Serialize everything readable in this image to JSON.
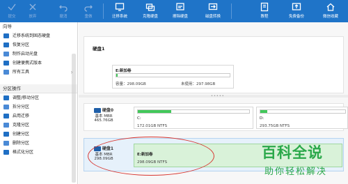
{
  "toolbar": {
    "commit": "提交",
    "discard": "放弃",
    "undo": "撤消",
    "redo": "重做",
    "migrate_os": "迁移系统",
    "clone_disk": "克隆硬盘",
    "wipe_disk": "擦除硬盘",
    "convert_disk": "磁盘转换",
    "tutorial": "教程",
    "free_backup": "免费备份",
    "wechat": "微信收藏"
  },
  "sidebar": {
    "wizard_header": "向导",
    "wizard_items": [
      "迁移系统到固态硬盘",
      "恢复分区",
      "制作启动光盘",
      "创建便携式版本",
      "所有工具"
    ],
    "partition_header": "分区操作",
    "partition_items": [
      "调整/移动分区",
      "拆分分区",
      "启用迁移",
      "克隆分区",
      "创建分区",
      "删除分区",
      "格式化分区"
    ]
  },
  "disk1_panel": {
    "title": "硬盘1",
    "volume_name": "E:新加卷",
    "capacity": "容量：298.09GB",
    "unused": "未使用：297.98GB",
    "used_fraction": 0.0004
  },
  "disk0": {
    "name": "硬盘0",
    "type": "基本 MBR",
    "size": "465.76GB",
    "c_name": "C:",
    "c_info": "172.01GB NTFS",
    "c_used_fraction": 0.3,
    "d_name": "D:",
    "d_info": "293.75GB NTFS",
    "d_used_fraction": 0.08
  },
  "disk1": {
    "name": "硬盘1",
    "type": "基本 MBR",
    "size": "298.09GB",
    "e_name": "E:新加卷",
    "e_info": "298.09GB NTFS"
  },
  "watermark": {
    "line1": "百科全说",
    "line2": "助你轻松解决"
  }
}
